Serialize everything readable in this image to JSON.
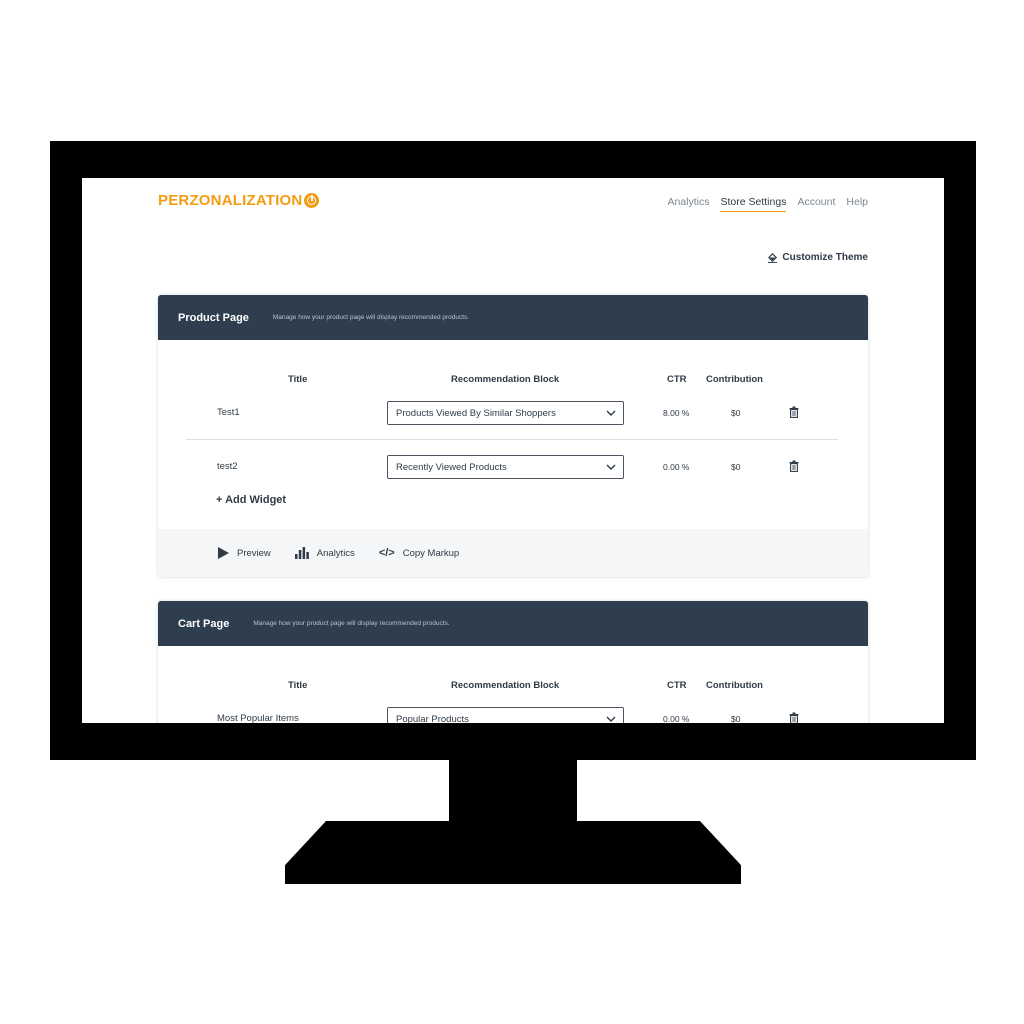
{
  "brand": {
    "name": "PERZONALIZATION",
    "accent_color": "#f39c12",
    "icon": "power-icon"
  },
  "nav": {
    "items": [
      "Analytics",
      "Store Settings",
      "Account",
      "Help"
    ],
    "active": "Store Settings"
  },
  "customize_theme": {
    "label": "Customize Theme",
    "icon": "paint-bucket-icon"
  },
  "columns": {
    "title": "Title",
    "block": "Recommendation Block",
    "ctr": "CTR",
    "contribution": "Contribution"
  },
  "product_page": {
    "title": "Product Page",
    "subtitle": "Manage how your product page will display recommended products.",
    "rows": [
      {
        "title": "Test1",
        "block": "Products Viewed By Similar Shoppers",
        "ctr": "8.00 %",
        "contribution": "$0"
      },
      {
        "title": "test2",
        "block": "Recently Viewed Products",
        "ctr": "0.00 %",
        "contribution": "$0"
      }
    ],
    "add_widget": "+ Add Widget",
    "footer": {
      "preview": "Preview",
      "analytics": "Analytics",
      "copy_markup": "Copy Markup"
    }
  },
  "cart_page": {
    "title": "Cart Page",
    "subtitle": "Manage how your product page will display recommended products.",
    "rows": [
      {
        "title": "Most Popular Items",
        "block": "Popular Products",
        "ctr": "0.00 %",
        "contribution": "$0"
      }
    ]
  },
  "colors": {
    "header_bar": "#2e3e4e",
    "footer_bg": "#f5f6f7",
    "monitor": "#000000"
  }
}
